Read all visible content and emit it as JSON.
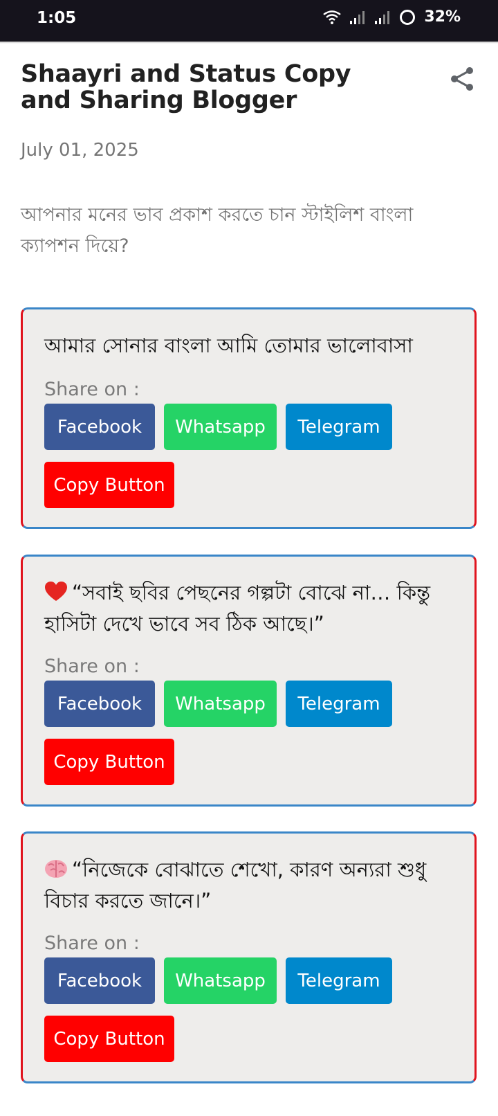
{
  "status_bar": {
    "time": "1:05",
    "battery": "32%"
  },
  "post": {
    "title": "Shaayri and Status Copy and Sharing Blogger",
    "date": "July 01, 2025",
    "intro": "আপনার মনের ভাব প্রকাশ করতে চান স্টাইলিশ বাংলা ক্যাপশন দিয়ে?"
  },
  "cards": [
    {
      "emoji": "",
      "quote": "আমার সোনার বাংলা আমি তোমার ভালোবাসা",
      "share_label": "Share on :",
      "facebook_label": "Facebook",
      "whatsapp_label": "Whatsapp",
      "telegram_label": "Telegram",
      "copy_label": "Copy Button"
    },
    {
      "emoji": "heart-icon",
      "quote": "“সবাই ছবির পেছনের গল্পটা বোঝে না… কিন্তু হাসিটা দেখে ভাবে সব ঠিক আছে।”",
      "share_label": "Share on :",
      "facebook_label": "Facebook",
      "whatsapp_label": "Whatsapp",
      "telegram_label": "Telegram",
      "copy_label": "Copy Button"
    },
    {
      "emoji": "brain-icon",
      "quote": "“নিজেকে বোঝাতে শেখো, কারণ অন্যরা শুধু বিচার করতে জানে।”",
      "share_label": "Share on :",
      "facebook_label": "Facebook",
      "whatsapp_label": "Whatsapp",
      "telegram_label": "Telegram",
      "copy_label": "Copy Button"
    }
  ],
  "colors": {
    "facebook": "#3b5998",
    "whatsapp": "#25d366",
    "telegram": "#0088cc",
    "copy": "#ff0000",
    "card_border": "#e0141e",
    "card_accent": "#3a86c8"
  }
}
